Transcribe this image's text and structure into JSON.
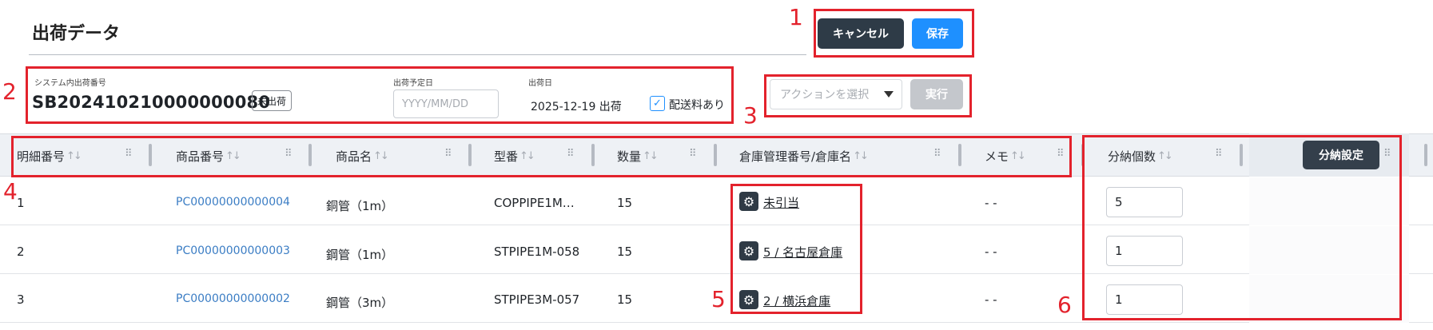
{
  "page": {
    "title": "出荷データ"
  },
  "actions": {
    "cancel_label": "キャンセル",
    "save_label": "保存"
  },
  "shipment": {
    "system_no_label": "システム内出荷番号",
    "system_no": "SB202410210000000080",
    "status_badge": "未出荷",
    "planned_date_label": "出荷予定日",
    "planned_date_placeholder": "YYYY/MM/DD",
    "ship_date_label": "出荷日",
    "ship_date_value": "2025-12-19 出荷",
    "shipping_fee_label": "配送料あり",
    "shipping_fee_checked": true
  },
  "bulk_action": {
    "placeholder": "アクションを選択",
    "execute_label": "実行"
  },
  "table": {
    "columns": [
      "明細番号",
      "商品番号",
      "商品名",
      "型番",
      "数量",
      "倉庫管理番号/倉庫名",
      "メモ",
      "分納個数"
    ],
    "split_settings_label": "分納設定",
    "rows": [
      {
        "line_no": "1",
        "product_no": "PC00000000000004",
        "product_name": "銅管（1m）",
        "model_no": "COPPIPE1M…",
        "qty": "15",
        "warehouse": "未引当",
        "memo": "- -",
        "split_qty": "5"
      },
      {
        "line_no": "2",
        "product_no": "PC00000000000003",
        "product_name": "鋼管（1m）",
        "model_no": "STPIPE1M-058",
        "qty": "15",
        "warehouse": "5 / 名古屋倉庫",
        "memo": "- -",
        "split_qty": "1"
      },
      {
        "line_no": "3",
        "product_no": "PC00000000000002",
        "product_name": "鋼管（3m）",
        "model_no": "STPIPE3M-057",
        "qty": "15",
        "warehouse": "2 / 横浜倉庫",
        "memo": "- -",
        "split_qty": "1"
      }
    ]
  },
  "annotations": [
    "1",
    "2",
    "3",
    "4",
    "5",
    "6"
  ],
  "colors": {
    "highlight_red": "#e3222c",
    "primary_blue": "#1e90ff",
    "dark_button": "#2e3b47"
  },
  "icons": {
    "sort": "sort-arrows-icon",
    "column_menu": "drag-dots-icon",
    "warehouse": "gear-icon",
    "checkbox": "check-icon",
    "select": "caret-down-icon"
  }
}
